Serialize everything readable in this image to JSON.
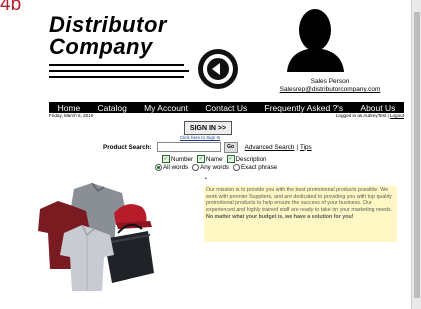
{
  "corner_label": "4b",
  "logo": {
    "line1": "Distributor",
    "line2": "Company"
  },
  "sales": {
    "person": "Sales Person",
    "email": "Salesrep@distributorcompany.com"
  },
  "nav": {
    "items": [
      "Home",
      "Catalog",
      "My Account",
      "Contact Us",
      "Frequently Asked ?'s",
      "About Us"
    ]
  },
  "date": "Friday, March 5, 2010",
  "login": {
    "prefix": "Logged in as AubreyTest |",
    "logout": "Logout"
  },
  "signin": {
    "label": "SIGN IN >>",
    "link": "Click here to Sign In"
  },
  "search": {
    "label": "Product Search:",
    "value": "",
    "go": "Go",
    "advanced": "Advanced Search",
    "separator": "|",
    "tips": "Tips"
  },
  "search_fields": [
    {
      "label": "Number",
      "checked": true
    },
    {
      "label": "Name",
      "checked": true
    },
    {
      "label": "Description",
      "checked": true
    }
  ],
  "search_modes": [
    {
      "label": "All words",
      "selected": true
    },
    {
      "label": "Any words",
      "selected": false
    },
    {
      "label": "Exact phrase",
      "selected": false
    }
  ],
  "bullet": "•",
  "mission": {
    "text": "Our mission is to provide you with the best promotional products possible. We work with premier Suppliers, and are dedicated to providing you with top quality promotional products to help ensure the success of your business. Our experienced and highly trained staff are ready to take on your marketing needs.",
    "bold": "No matter what your budget is, we have a solution for you!"
  },
  "colors": {
    "nav_bg": "#000000",
    "mission_bg": "#fff8c4",
    "corner_label": "#b5212b",
    "check": "#1b6e1b"
  }
}
